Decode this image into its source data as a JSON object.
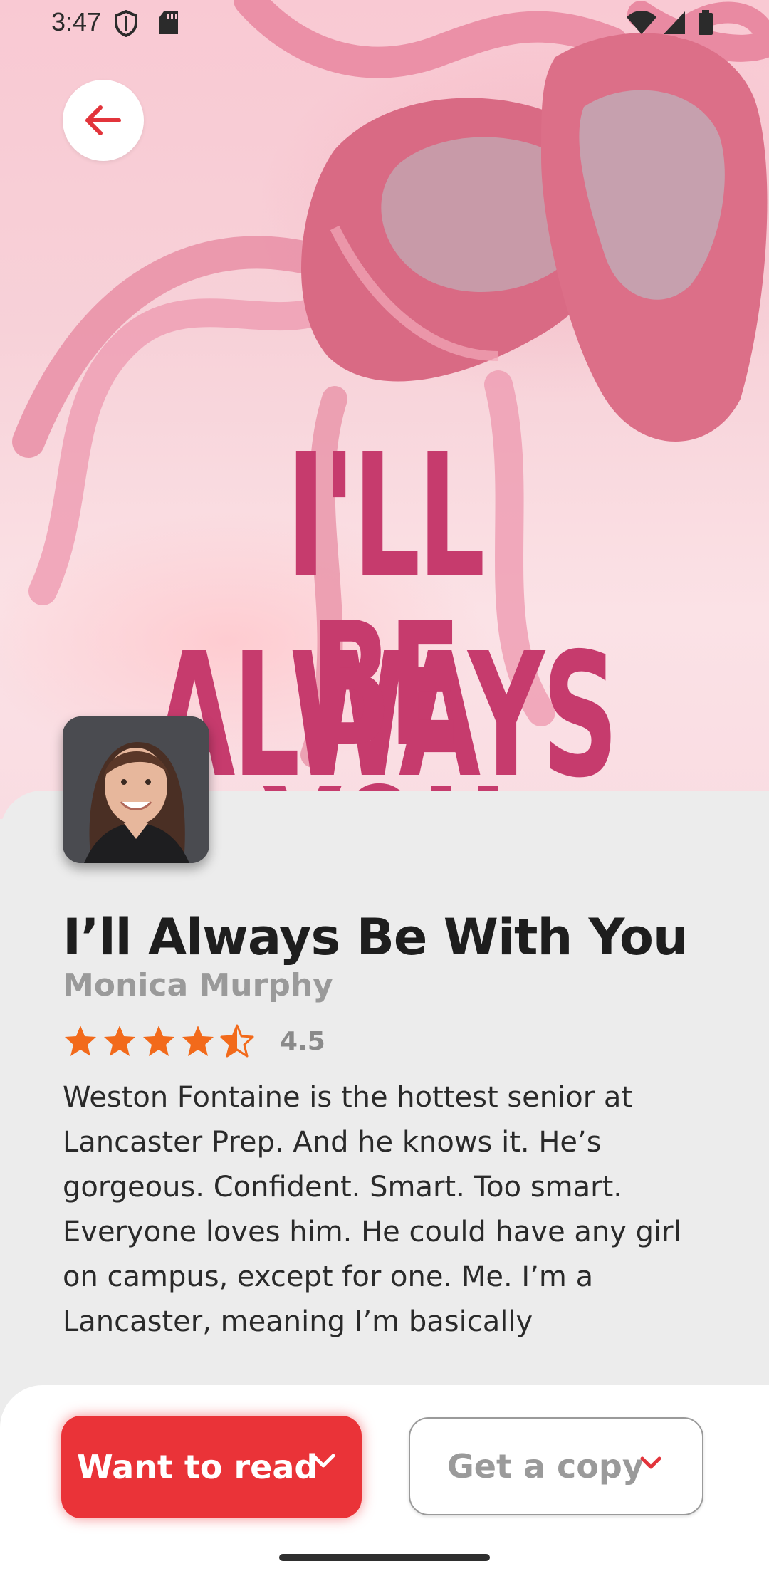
{
  "status_bar": {
    "time": "3:47",
    "icons": [
      "shield-icon",
      "sd-card-icon",
      "wifi-icon",
      "signal-icon",
      "battery-icon"
    ]
  },
  "header": {
    "back_icon": "arrow-left-icon"
  },
  "cover": {
    "line1": "I'LL ALWAYS",
    "line2": "BE WITH",
    "line3": "YOU"
  },
  "book": {
    "title": "I’ll Always Be With You",
    "author": "Monica Murphy",
    "rating": 4.5,
    "rating_text": "4.5",
    "description": "Weston Fontaine is the hottest senior at Lancaster Prep. And he knows it. He’s gorgeous. Confident. Smart. Too smart. Everyone loves him. He could have any girl on campus, except for one. Me. I’m a Lancaster, meaning I’m basically untouchable–or so I thought. It’s my"
  },
  "actions": {
    "want_to_read": "Want to read",
    "get_a_copy": "Get a copy"
  },
  "colors": {
    "accent": "#ea3338",
    "star": "#f26a1b",
    "cover_title": "#c63b6d"
  }
}
